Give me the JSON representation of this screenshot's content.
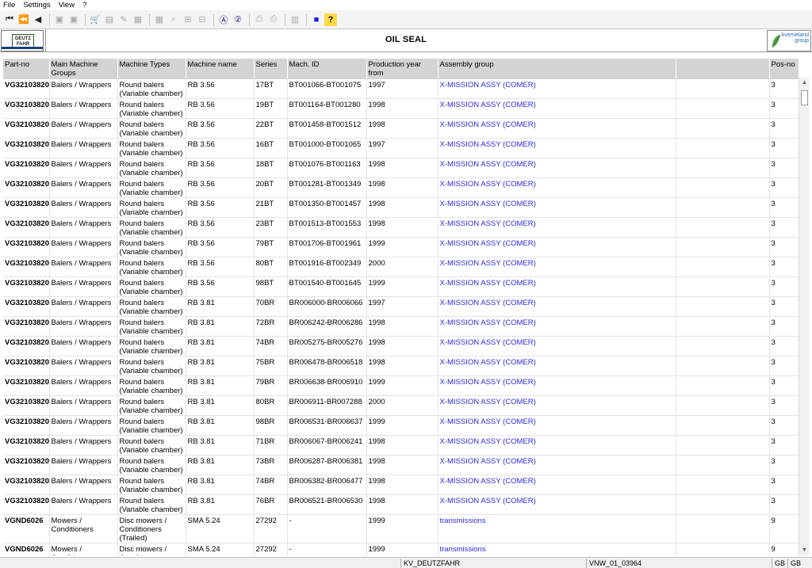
{
  "menu": [
    "File",
    "Settings",
    "View",
    "?"
  ],
  "toolbar": {
    "buttons": [
      {
        "icon": "first-page-icon",
        "glyph": "⏮",
        "enabled": true
      },
      {
        "icon": "previous-page-icon",
        "glyph": "⏪",
        "enabled": true
      },
      {
        "icon": "back-icon",
        "glyph": "◀",
        "enabled": true
      },
      {
        "icon": "page-prev-icon",
        "glyph": "▣",
        "enabled": false
      },
      {
        "icon": "page-next-icon",
        "glyph": "▣",
        "enabled": false
      },
      {
        "icon": "cart-icon",
        "glyph": "🛒",
        "enabled": true
      },
      {
        "icon": "list-icon",
        "glyph": "▤",
        "enabled": false
      },
      {
        "icon": "edit-icon",
        "glyph": "✎",
        "enabled": false
      },
      {
        "icon": "print-layout-icon",
        "glyph": "▦",
        "enabled": false
      },
      {
        "icon": "grid-icon",
        "glyph": "▦",
        "enabled": false
      },
      {
        "icon": "zoom-icon",
        "glyph": "⌕",
        "enabled": false
      },
      {
        "icon": "zoom-in-icon",
        "glyph": "⊞",
        "enabled": false
      },
      {
        "icon": "zoom-out-icon",
        "glyph": "⊟",
        "enabled": false
      },
      {
        "icon": "search-a-icon",
        "glyph": "Ⓐ",
        "enabled": true
      },
      {
        "icon": "search-2-icon",
        "glyph": "②",
        "enabled": true
      },
      {
        "icon": "print-icon",
        "glyph": "⎙",
        "enabled": false
      },
      {
        "icon": "print-preview-icon",
        "glyph": "⎙",
        "enabled": false
      },
      {
        "icon": "book-icon",
        "glyph": "▥",
        "enabled": false
      },
      {
        "icon": "stop-icon",
        "glyph": "■",
        "enabled": true
      },
      {
        "icon": "help-icon",
        "glyph": "?",
        "enabled": true
      }
    ]
  },
  "header": {
    "title": "OIL SEAL",
    "left_logo": [
      "DEUTZ",
      "FAHR"
    ],
    "right_logo": [
      "kverneland",
      "group"
    ]
  },
  "table": {
    "columns": [
      "Part-no",
      "Main Machine Groups",
      "Machine Types",
      "Machine name",
      "Series",
      "Mach. ID",
      "Production year from",
      "Assembly group",
      "",
      "Pos-no"
    ],
    "rows": [
      [
        "VG32103820",
        "Balers / Wrappers",
        "Round balers (Variable chamber)",
        "RB 3.56",
        "17BT",
        "BT001066-BT001075",
        "1997",
        "X-MISSION ASSY (COMER)",
        "3"
      ],
      [
        "VG32103820",
        "Balers / Wrappers",
        "Round balers (Variable chamber)",
        "RB 3.56",
        "19BT",
        "BT001164-BT001280",
        "1998",
        "X-MISSION ASSY (COMER)",
        "3"
      ],
      [
        "VG32103820",
        "Balers / Wrappers",
        "Round balers (Variable chamber)",
        "RB 3.56",
        "22BT",
        "BT001458-BT001512",
        "1998",
        "X-MISSION ASSY (COMER)",
        "3"
      ],
      [
        "VG32103820",
        "Balers / Wrappers",
        "Round balers (Variable chamber)",
        "RB 3.56",
        "16BT",
        "BT001000-BT001065",
        "1997",
        "X-MISSION ASSY (COMER)",
        "3"
      ],
      [
        "VG32103820",
        "Balers / Wrappers",
        "Round balers (Variable chamber)",
        "RB 3.56",
        "18BT",
        "BT001076-BT001163",
        "1998",
        "X-MISSION ASSY (COMER)",
        "3"
      ],
      [
        "VG32103820",
        "Balers / Wrappers",
        "Round balers (Variable chamber)",
        "RB 3.56",
        "20BT",
        "BT001281-BT001349",
        "1998",
        "X-MISSION ASSY (COMER)",
        "3"
      ],
      [
        "VG32103820",
        "Balers / Wrappers",
        "Round balers (Variable chamber)",
        "RB 3.56",
        "21BT",
        "BT001350-BT001457",
        "1998",
        "X-MISSION ASSY (COMER)",
        "3"
      ],
      [
        "VG32103820",
        "Balers / Wrappers",
        "Round balers (Variable chamber)",
        "RB 3.56",
        "23BT",
        "BT001513-BT001553",
        "1998",
        "X-MISSION ASSY (COMER)",
        "3"
      ],
      [
        "VG32103820",
        "Balers / Wrappers",
        "Round balers (Variable chamber)",
        "RB 3.56",
        "79BT",
        "BT001706-BT001961",
        "1999",
        "X-MISSION ASSY (COMER)",
        "3"
      ],
      [
        "VG32103820",
        "Balers / Wrappers",
        "Round balers (Variable chamber)",
        "RB 3.56",
        "80BT",
        "BT001916-BT002349",
        "2000",
        "X-MISSION ASSY (COMER)",
        "3"
      ],
      [
        "VG32103820",
        "Balers / Wrappers",
        "Round balers (Variable chamber)",
        "RB 3.56",
        "98BT",
        "BT001540-BT001645",
        "1999",
        "X-MISSION ASSY (COMER)",
        "3"
      ],
      [
        "VG32103820",
        "Balers / Wrappers",
        "Round balers (Variable chamber)",
        "RB 3.81",
        "70BR",
        "BR006000-BR006066",
        "1997",
        "X-MISSION ASSY (COMER)",
        "3"
      ],
      [
        "VG32103820",
        "Balers / Wrappers",
        "Round balers (Variable chamber)",
        "RB 3.81",
        "72BR",
        "BR006242-BR006286",
        "1998",
        "X-MISSION ASSY (COMER)",
        "3"
      ],
      [
        "VG32103820",
        "Balers / Wrappers",
        "Round balers (Variable chamber)",
        "RB 3.81",
        "74BR",
        "BR005275-BR005276",
        "1998",
        "X-MISSION ASSY (COMER)",
        "3"
      ],
      [
        "VG32103820",
        "Balers / Wrappers",
        "Round balers (Variable chamber)",
        "RB 3.81",
        "75BR",
        "BR006478-BR006518",
        "1998",
        "X-MISSION ASSY (COMER)",
        "3"
      ],
      [
        "VG32103820",
        "Balers / Wrappers",
        "Round balers (Variable chamber)",
        "RB 3.81",
        "79BR",
        "BR006638-BR006910",
        "1999",
        "X-MISSION ASSY (COMER)",
        "3"
      ],
      [
        "VG32103820",
        "Balers / Wrappers",
        "Round balers (Variable chamber)",
        "RB 3.81",
        "80BR",
        "BR006911-BR007288",
        "2000",
        "X-MISSION ASSY (COMER)",
        "3"
      ],
      [
        "VG32103820",
        "Balers / Wrappers",
        "Round balers (Variable chamber)",
        "RB 3.81",
        "98BR",
        "BR006531-BR006637",
        "1999",
        "X-MISSION ASSY (COMER)",
        "3"
      ],
      [
        "VG32103820",
        "Balers / Wrappers",
        "Round balers (Variable chamber)",
        "RB 3.81",
        "71BR",
        "BR006067-BR006241",
        "1998",
        "X-MISSION ASSY (COMER)",
        "3"
      ],
      [
        "VG32103820",
        "Balers / Wrappers",
        "Round balers (Variable chamber)",
        "RB 3.81",
        "73BR",
        "BR006287-BR006381",
        "1998",
        "X-MISSION ASSY (COMER)",
        "3"
      ],
      [
        "VG32103820",
        "Balers / Wrappers",
        "Round balers (Variable chamber)",
        "RB 3.81",
        "74BR",
        "BR006382-BR006477",
        "1998",
        "X-MISSION ASSY (COMER)",
        "3"
      ],
      [
        "VG32103820",
        "Balers / Wrappers",
        "Round balers (Variable chamber)",
        "RB 3.81",
        "76BR",
        "BR006521-BR006530",
        "1998",
        "X-MISSION ASSY (COMER)",
        "3"
      ],
      [
        "VGND6026",
        "Mowers / Conditioners",
        "Disc mowers / Conditioners (Trailed)",
        "SMA 5.24",
        "27292",
        "-",
        "1999",
        "transmissions",
        "9"
      ],
      [
        "VGND6026",
        "Mowers / Conditioners",
        "Disc mowers / Conditioners (Trailed)",
        "SMA 5.24",
        "27292",
        "-",
        "1999",
        "transmissions",
        "9"
      ]
    ]
  },
  "statusbar": {
    "database": "KV_DEUTZFAHR",
    "version": "VNW_01_03964",
    "lang1": "GB",
    "lang2": "GB"
  }
}
